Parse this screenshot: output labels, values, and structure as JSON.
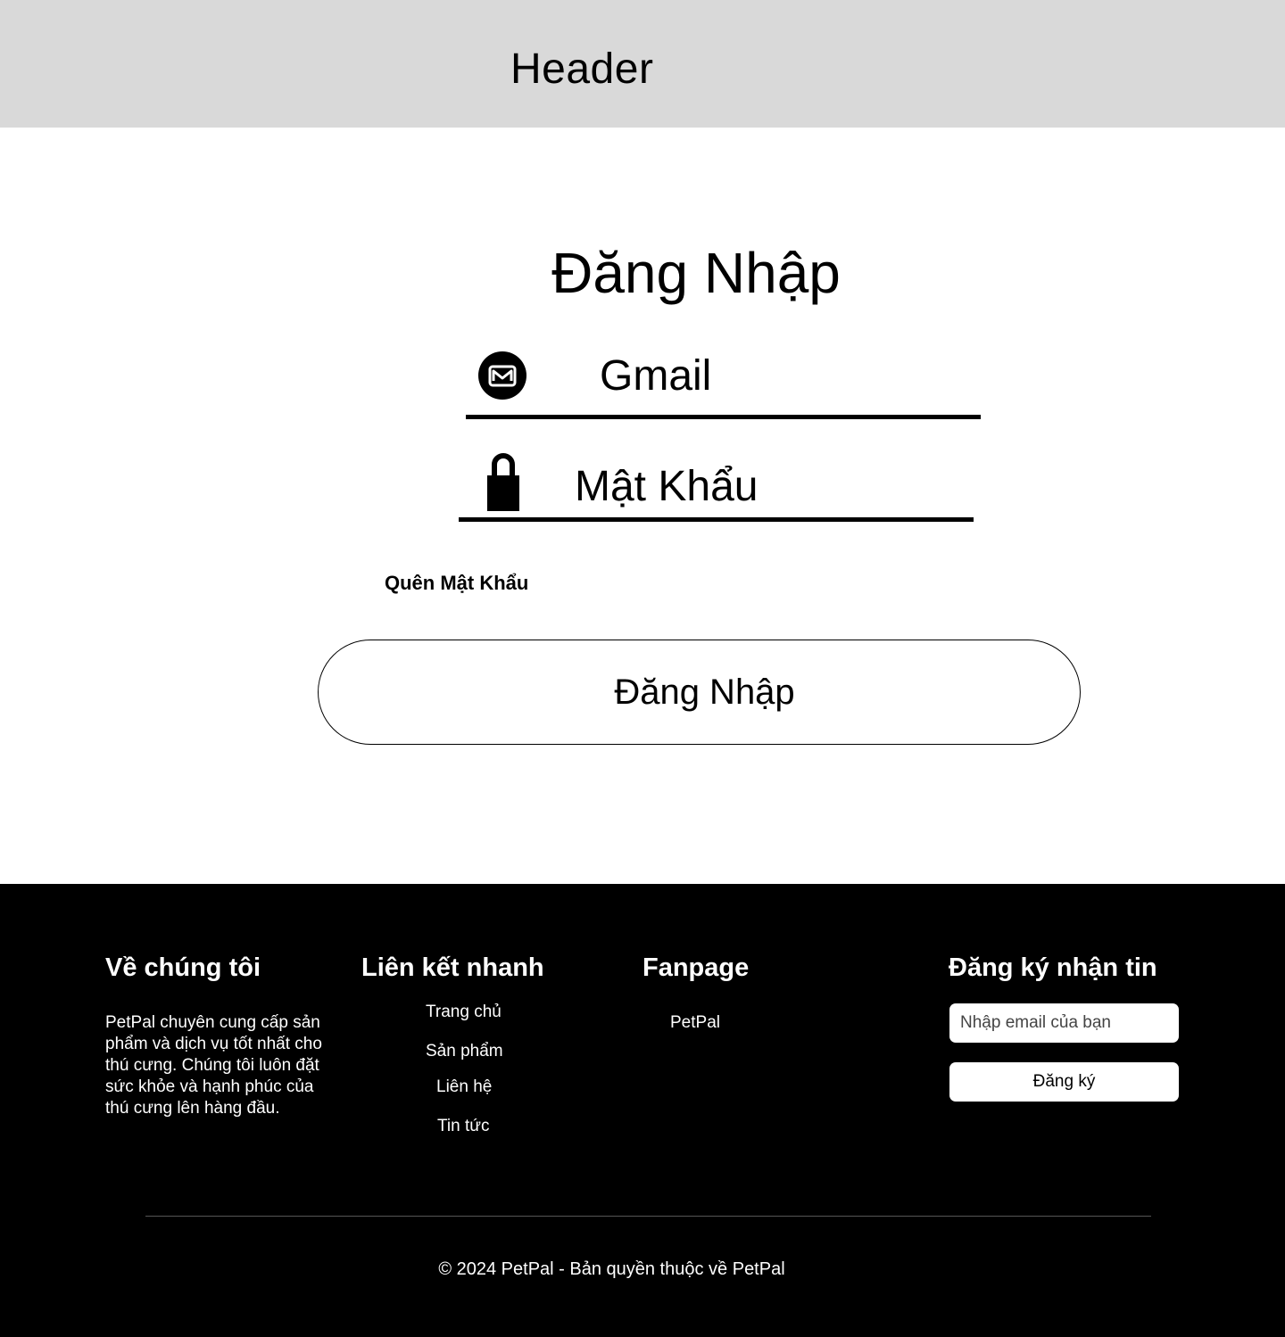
{
  "header": {
    "title": "Header"
  },
  "login": {
    "title": "Đăng Nhập",
    "email_label": "Gmail",
    "password_label": "Mật Khẩu",
    "forgot_password": "Quên Mật Khẩu",
    "submit_label": "Đăng Nhập"
  },
  "icons": {
    "email": "gmail-icon",
    "password": "lock-icon"
  },
  "footer": {
    "about": {
      "heading": "Về chúng tôi",
      "text": "PetPal chuyên cung cấp sản phẩm và dịch vụ tốt nhất cho thú cưng. Chúng tôi luôn đặt sức khỏe và hạnh phúc của thú cưng lên hàng đầu."
    },
    "quick_links": {
      "heading": "Liên kết nhanh",
      "items": [
        "Trang chủ",
        "Sản phẩm",
        "Liên hệ",
        "Tin tức"
      ]
    },
    "fanpage": {
      "heading": "Fanpage",
      "items": [
        "PetPal"
      ]
    },
    "newsletter": {
      "heading": "Đăng ký nhận tin",
      "placeholder": "Nhập email của bạn",
      "button_label": "Đăng ký"
    },
    "copyright": "© 2024 PetPal - Bản quyền thuộc về PetPal"
  },
  "colors": {
    "header_bg": "#d9d9d9",
    "footer_bg": "#000000",
    "text": "#000000"
  }
}
